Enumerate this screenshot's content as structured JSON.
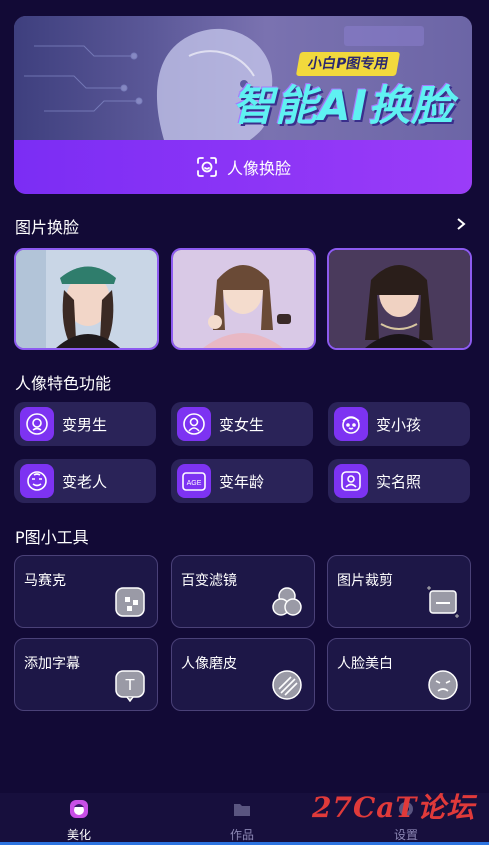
{
  "banner": {
    "tag": "小白P图专用",
    "title": "智能AI换脸",
    "button_label": "人像换脸"
  },
  "sections": {
    "photo_swap": "图片换脸",
    "portrait_features": "人像特色功能",
    "tools": "P图小工具"
  },
  "features": [
    {
      "label": "变男生",
      "icon": "male-face-icon"
    },
    {
      "label": "变女生",
      "icon": "female-face-icon"
    },
    {
      "label": "变小孩",
      "icon": "child-face-icon"
    },
    {
      "label": "变老人",
      "icon": "elder-face-icon"
    },
    {
      "label": "变年龄",
      "icon": "age-icon",
      "icon_text": "AGE"
    },
    {
      "label": "实名照",
      "icon": "id-photo-icon"
    }
  ],
  "tools": [
    {
      "label": "马赛克",
      "icon": "mosaic-icon"
    },
    {
      "label": "百变滤镜",
      "icon": "filter-icon"
    },
    {
      "label": "图片裁剪",
      "icon": "crop-icon"
    },
    {
      "label": "添加字幕",
      "icon": "text-icon",
      "icon_text": "T"
    },
    {
      "label": "人像磨皮",
      "icon": "smooth-skin-icon"
    },
    {
      "label": "人脸美白",
      "icon": "whiten-face-icon"
    }
  ],
  "nav": [
    {
      "label": "美化",
      "active": true
    },
    {
      "label": "作品",
      "active": false
    },
    {
      "label": "设置",
      "active": false
    }
  ],
  "watermark": "27CaT论坛",
  "colors": {
    "background": "#120a36",
    "accent": "#7d33f2",
    "card": "#2a2358"
  }
}
